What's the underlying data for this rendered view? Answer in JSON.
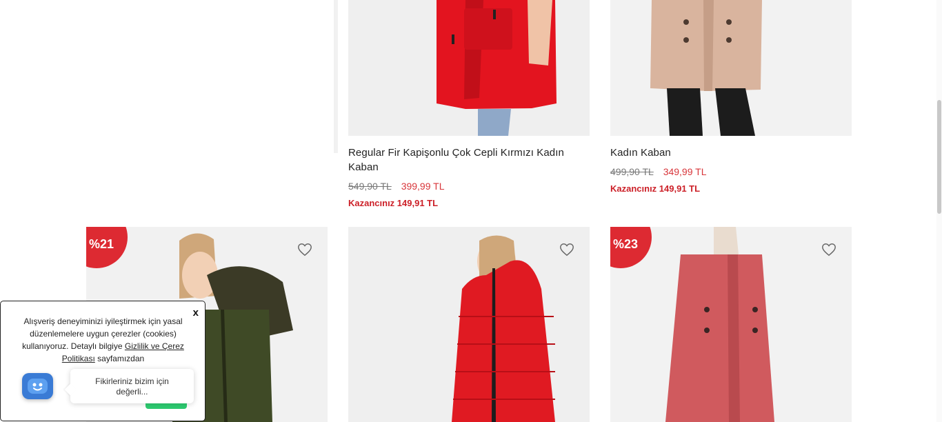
{
  "products_top": [
    {
      "title": "Regular Fir Kapişonlu Çok Cepli Kırmızı Kadın Kaban",
      "old_price": "549,90 TL",
      "new_price": "399,99 TL",
      "gain": "Kazancınız 149,91 TL"
    },
    {
      "title": "Kadın Kaban",
      "old_price": "499,90 TL",
      "new_price": "349,99 TL",
      "gain": "Kazancınız 149,91 TL"
    }
  ],
  "products_bottom": [
    {
      "badge": "%21"
    },
    {
      "badge": ""
    },
    {
      "badge": "%23"
    }
  ],
  "cookie": {
    "close": "x",
    "text_before": "Alışveriş deneyiminizi iyileştirmek için yasal düzenlemelere uygun çerezler (cookies) kullanıyoruz. Detaylı bilgiye",
    "link": "Gizlilik ve Çerez Politikası",
    "text_after": "sayfamızdan"
  },
  "chat": {
    "tip": "Fikirleriniz bizim için değerli..."
  },
  "colors": {
    "accent_red": "#dd2a32",
    "price_red": "#d8353a",
    "chat_blue": "#3a7bd5"
  },
  "icons": [
    "heart-icon",
    "chat-bot-icon"
  ]
}
